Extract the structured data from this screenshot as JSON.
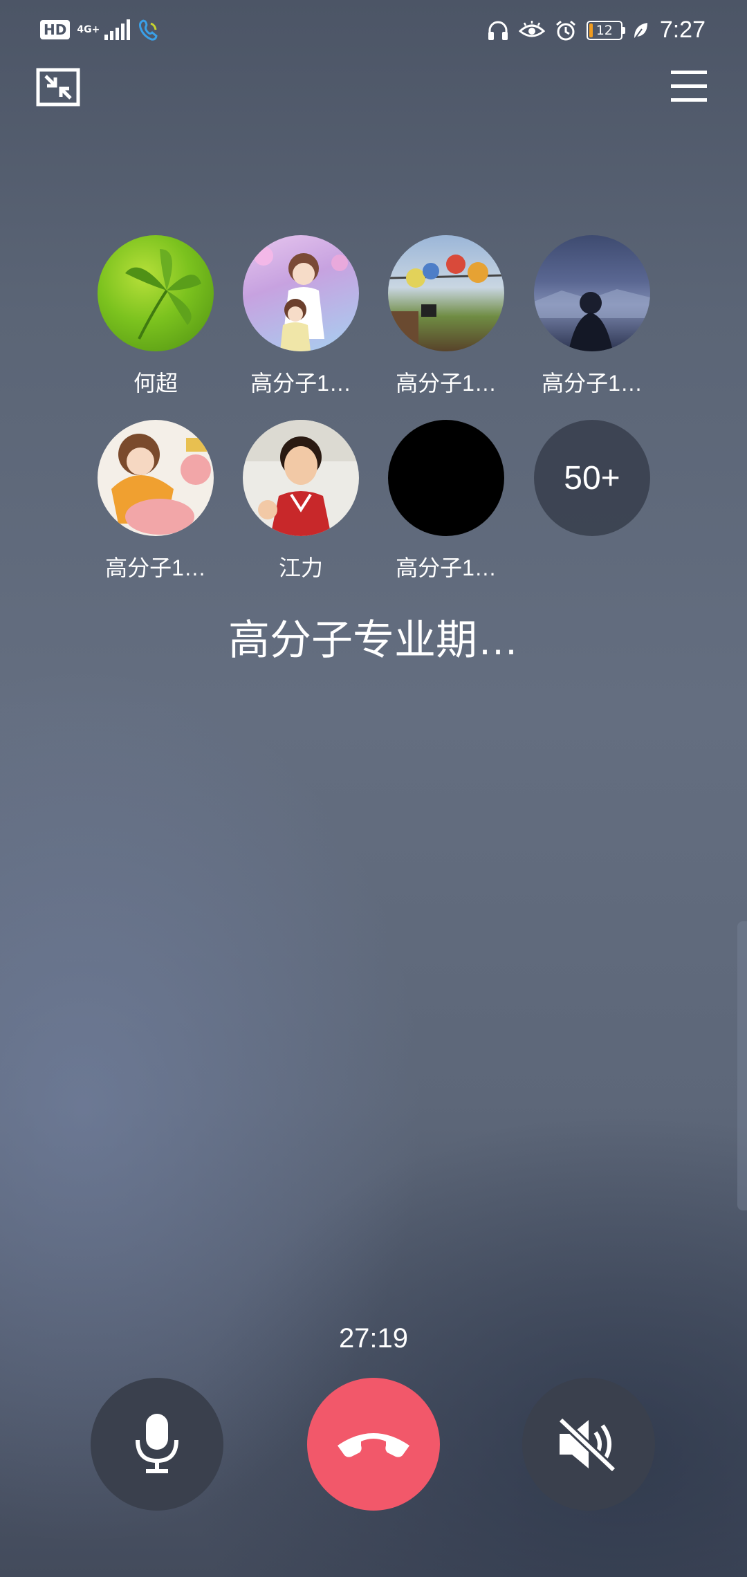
{
  "status_bar": {
    "hd": "HD",
    "network": "4G+",
    "battery": "12",
    "battery_level": 0.12,
    "battery_color": "#f29c1f",
    "time": "7:27",
    "icons": [
      "signal-icon",
      "call-wifi-icon",
      "headphones-icon",
      "eye-icon",
      "alarm-icon",
      "leaf-icon"
    ]
  },
  "top_bar": {
    "minimize_icon": "minimize-window-icon",
    "menu_icon": "hamburger-menu-icon"
  },
  "participants": [
    {
      "name": "何超",
      "avatar": "green-leaf"
    },
    {
      "name": "高分子1…",
      "avatar": "anime-girls"
    },
    {
      "name": "高分子1…",
      "avatar": "plush-toys"
    },
    {
      "name": "高分子1…",
      "avatar": "night-landscape"
    },
    {
      "name": "高分子1…",
      "avatar": "cartoon-pig"
    },
    {
      "name": "江力",
      "avatar": "basketball-anime"
    },
    {
      "name": "高分子1…",
      "avatar": "black"
    }
  ],
  "more_count": "50+",
  "group_name": "高分子专业期…",
  "call_timer": "27:19",
  "controls": {
    "mic_icon": "microphone-icon",
    "hangup_icon": "hang-up-icon",
    "speaker_icon": "speaker-muted-icon",
    "hangup_color": "#f2586a"
  }
}
